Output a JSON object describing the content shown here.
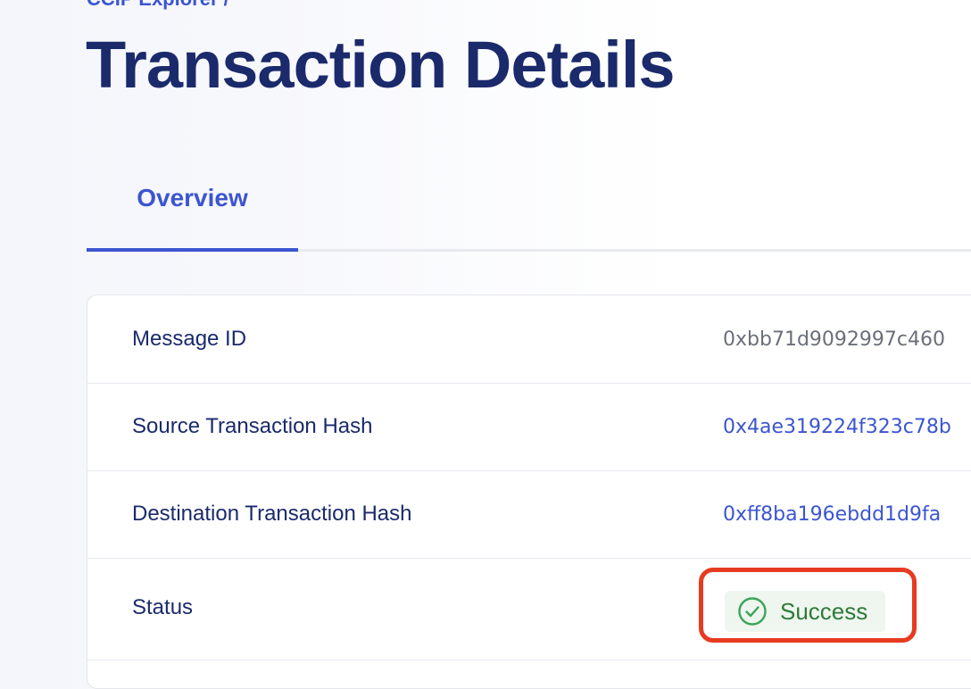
{
  "breadcrumb": {
    "label": "CCIP Explorer /"
  },
  "page": {
    "title": "Transaction Details"
  },
  "tabs": [
    {
      "label": "Overview",
      "active": true
    }
  ],
  "details": {
    "message_id": {
      "label": "Message ID",
      "value": "0xbb71d9092997c460"
    },
    "source_tx": {
      "label": "Source Transaction Hash",
      "value": "0x4ae319224f323c78b"
    },
    "destination_tx": {
      "label": "Destination Transaction Hash",
      "value": "0xff8ba196ebdd1d9fa"
    },
    "status": {
      "label": "Status",
      "value": "Success",
      "icon": "check-circle-icon"
    }
  },
  "colors": {
    "accent": "#3c55d0",
    "title": "#1b2a6b",
    "success_bg": "#eef6ef",
    "success_text": "#2f7a3a",
    "highlight": "#e63b20"
  }
}
